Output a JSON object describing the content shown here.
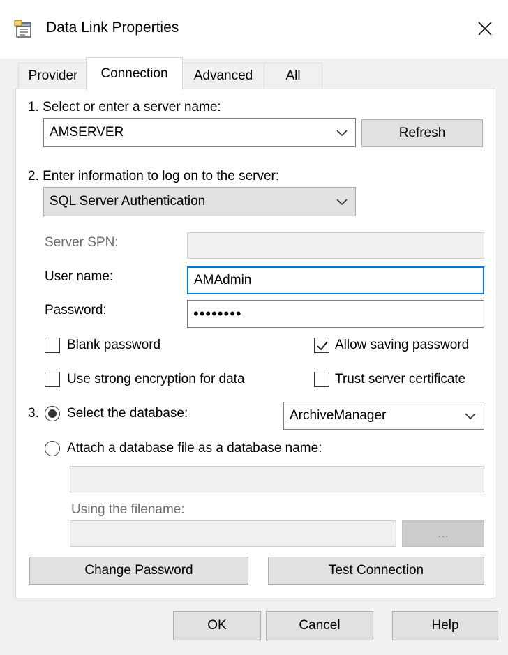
{
  "window": {
    "title": "Data Link Properties",
    "icon": "data-link-icon",
    "close_icon": "close-icon"
  },
  "tabs": [
    {
      "label": "Provider"
    },
    {
      "label": "Connection",
      "active": true
    },
    {
      "label": "Advanced"
    },
    {
      "label": "All"
    }
  ],
  "step1": {
    "label": "1. Select or enter a server name:",
    "server_value": "AMSERVER",
    "refresh_label": "Refresh"
  },
  "step2": {
    "label": "2. Enter information to log on to the server:",
    "auth_value": "SQL Server Authentication",
    "spn_label": "Server SPN:",
    "spn_value": "",
    "user_label": "User name:",
    "user_value": "AMAdmin",
    "password_label": "Password:",
    "password_value": "••••••••",
    "blank_password_label": "Blank password",
    "blank_password_checked": false,
    "allow_saving_label": "Allow saving password",
    "allow_saving_checked": true,
    "strong_encryption_label": "Use strong encryption for data",
    "strong_encryption_checked": false,
    "trust_cert_label": "Trust server certificate",
    "trust_cert_checked": false
  },
  "step3": {
    "number": "3.",
    "select_db_label": "Select the database:",
    "select_db_selected": true,
    "database_value": "ArchiveManager",
    "attach_label": "Attach a database file as a database name:",
    "attach_value": "",
    "filename_label": "Using the filename:",
    "filename_value": "",
    "browse_label": "..."
  },
  "panel_buttons": {
    "change_password": "Change Password",
    "test_connection": "Test Connection"
  },
  "footer": {
    "ok": "OK",
    "cancel": "Cancel",
    "help": "Help"
  }
}
